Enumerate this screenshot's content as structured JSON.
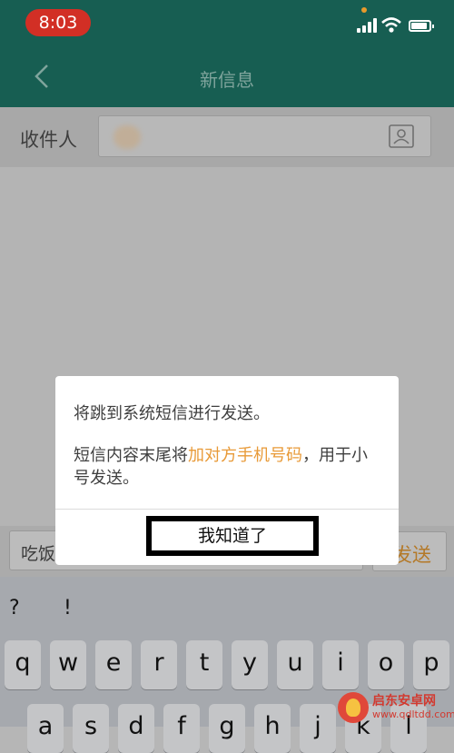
{
  "status_bar": {
    "time": "8:03"
  },
  "nav": {
    "title": "新信息"
  },
  "recipient": {
    "label": "收件人"
  },
  "message_bar": {
    "input_text": "吃饭",
    "send_label": "发送"
  },
  "dialog": {
    "line1": "将跳到系统短信进行发送。",
    "line2_before": "短信内容末尾将",
    "line2_highlight": "加对方手机号码",
    "line2_after": "，用于小号发送。",
    "button_label": "我知道了",
    "highlight_color": "#e89a38"
  },
  "keyboard": {
    "suggestions": [
      "?",
      "!"
    ],
    "row1": [
      "q",
      "w",
      "e",
      "r",
      "t",
      "y",
      "u",
      "i",
      "o",
      "p"
    ],
    "row2": [
      "a",
      "s",
      "d",
      "f",
      "g",
      "h",
      "j",
      "k",
      "l"
    ]
  },
  "watermark": {
    "title": "启东安卓网",
    "url": "www.qdltdd.com"
  }
}
